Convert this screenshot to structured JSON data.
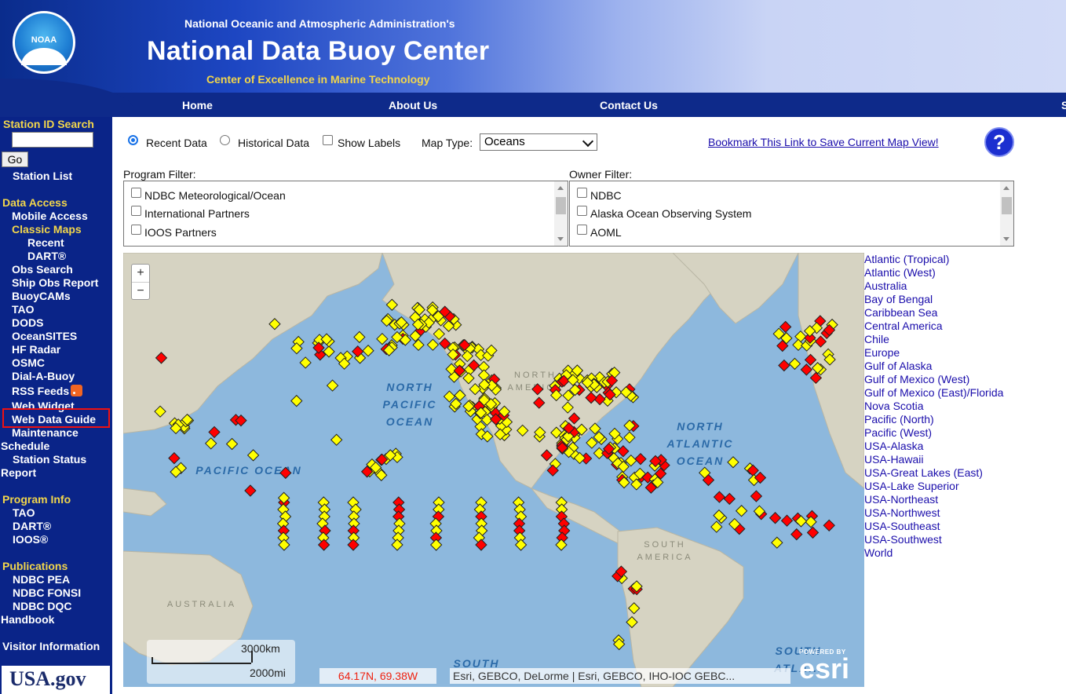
{
  "header": {
    "logo_text": "NOAA",
    "org": "National Oceanic and Atmospheric Administration's",
    "title": "National Data Buoy Center",
    "subtitle": "Center of Excellence in Marine Technology"
  },
  "nav": {
    "home": "Home",
    "about": "About Us",
    "contact": "Contact Us",
    "search": "S"
  },
  "sidebar": {
    "station_id_search": "Station ID Search",
    "go": "Go",
    "station_list": "Station List",
    "data_access": "Data Access",
    "mobile_access": "Mobile Access",
    "classic_maps": "Classic Maps",
    "recent": "Recent",
    "dart": "DART®",
    "obs_search": "Obs Search",
    "ship_obs_report": "Ship Obs Report",
    "buoycams": "BuoyCAMs",
    "tao": "TAO",
    "dods": "DODS",
    "oceansites": "OceanSITES",
    "hf_radar": "HF Radar",
    "osmc": "OSMC",
    "dial_a_buoy": "Dial-A-Buoy",
    "rss_feeds": "RSS Feeds",
    "web_widget": "Web Widget",
    "web_data_guide": "Web Data Guide",
    "maintenance": "Maintenance",
    "schedule": "Schedule",
    "station_status": "Station Status",
    "report": "Report",
    "program_info": "Program Info",
    "pi_tao": "TAO",
    "pi_dart": "DART®",
    "pi_ioos": "IOOS®",
    "publications": "Publications",
    "ndbc_pea": "NDBC PEA",
    "ndbc_fonsi": "NDBC FONSI",
    "ndbc_dqc": "NDBC DQC",
    "handbook": "Handbook",
    "visitor_info": "Visitor Information",
    "usagov": "USA.gov"
  },
  "controls": {
    "recent_data": "Recent Data",
    "historical_data": "Historical Data",
    "show_labels": "Show Labels",
    "map_type_label": "Map Type:",
    "map_type_value": "Oceans",
    "bookmark": "Bookmark This Link to Save Current Map View!",
    "help": "?"
  },
  "program_filter": {
    "label": "Program Filter:",
    "items": [
      "NDBC Meteorological/Ocean",
      "International Partners",
      "IOOS Partners"
    ]
  },
  "owner_filter": {
    "label": "Owner Filter:",
    "items": [
      "NDBC",
      "Alaska Ocean Observing System",
      "AOML"
    ]
  },
  "map": {
    "zoom_in": "+",
    "zoom_out": "−",
    "scale_km": "3000km",
    "scale_mi": "2000mi",
    "coords": "64.17N, 69.38W",
    "attribution": "Esri, GEBCO, DeLorme | Esri, GEBCO, IHO-IOC GEBC...",
    "esri_powered": "POWERED BY",
    "esri": "esri",
    "labels": {
      "north_pacific": "NORTH PACIFIC OCEAN",
      "pacific": "PACIFIC OCEAN",
      "north_atlantic": "NORTH ATLANTIC OCEAN",
      "north_america": "NORTH AMERICA",
      "south_america": "SOUTH AMERICA",
      "australia": "AUSTRALIA",
      "south": "SOUTH",
      "south_atlantic": "SOUTH ATLA..."
    },
    "colors": {
      "ocean": "#8db8dd",
      "land": "#d6d3c2",
      "buoy_yellow": "#ffff00",
      "buoy_red": "#ff0000"
    }
  },
  "regions": [
    "Atlantic (Tropical)",
    "Atlantic (West)",
    "Australia",
    "Bay of Bengal",
    "Caribbean Sea",
    "Central America",
    "Chile",
    "Europe",
    "Gulf of Alaska",
    "Gulf of Mexico (West)",
    "Gulf of Mexico (East)/Florida",
    "Nova Scotia",
    "Pacific (North)",
    "Pacific (West)",
    "USA-Alaska",
    "USA-Hawaii",
    "USA-Great Lakes (East)",
    "USA-Lake Superior",
    "USA-Northeast",
    "USA-Northwest",
    "USA-Southeast",
    "USA-Southwest",
    "World"
  ]
}
